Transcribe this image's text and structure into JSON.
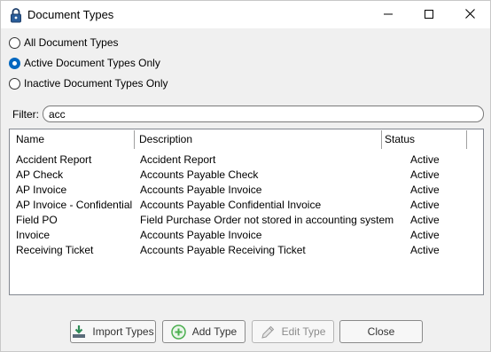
{
  "window": {
    "title": "Document Types"
  },
  "status_options": [
    {
      "label": "All Document Types",
      "checked": false
    },
    {
      "label": "Active Document Types Only",
      "checked": true
    },
    {
      "label": "Inactive Document Types Only",
      "checked": false
    }
  ],
  "filter": {
    "label": "Filter:",
    "value": "acc"
  },
  "list": {
    "columns": [
      "Name",
      "Description",
      "Status"
    ],
    "rows": [
      {
        "name": "Accident Report",
        "description": "Accident Report",
        "status": "Active"
      },
      {
        "name": "AP Check",
        "description": "Accounts Payable Check",
        "status": "Active"
      },
      {
        "name": "AP Invoice",
        "description": "Accounts Payable Invoice",
        "status": "Active"
      },
      {
        "name": "AP Invoice - Confidential",
        "description": "Accounts Payable Confidential Invoice",
        "status": "Active"
      },
      {
        "name": "Field PO",
        "description": "Field Purchase Order not stored in accounting system",
        "status": "Active"
      },
      {
        "name": "Invoice",
        "description": "Accounts Payable Invoice",
        "status": "Active"
      },
      {
        "name": "Receiving Ticket",
        "description": "Accounts Payable Receiving Ticket",
        "status": "Active"
      }
    ]
  },
  "buttons": {
    "import": "Import Types",
    "add": "Add Type",
    "edit": "Edit Type",
    "close": "Close"
  },
  "icons": {
    "app": "padlock-icon",
    "minimize": "minimize-icon",
    "maximize": "maximize-icon",
    "close": "close-icon",
    "import": "import-icon",
    "add": "add-icon",
    "edit": "pencil-icon"
  },
  "colors": {
    "radio_accent": "#0067c0",
    "add_icon": "#4caf50",
    "import_icon": "#2e8b57"
  }
}
